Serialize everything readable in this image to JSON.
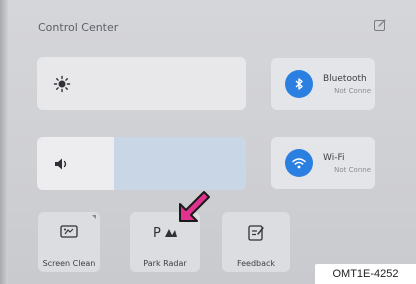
{
  "header": {
    "title": "Control Center",
    "edit_icon": "edit-square-icon"
  },
  "sliders": {
    "brightness": {
      "icon": "sun-icon",
      "level": 0.0
    },
    "volume": {
      "icon": "speaker-icon",
      "level": 0.37
    }
  },
  "toggles": {
    "bluetooth": {
      "label": "Bluetooth",
      "status": "Not Conne",
      "icon": "bluetooth-icon",
      "color": "#2a7fe0"
    },
    "wifi": {
      "label": "Wi-Fi",
      "status": "Not Conne",
      "icon": "wifi-icon",
      "color": "#2a7fe0"
    }
  },
  "tiles": {
    "screen_clean": {
      "label": "Screen Clean",
      "icon": "screen-clean-icon"
    },
    "park_radar": {
      "label": "Park Radar",
      "icon": "park-radar-icon"
    },
    "feedback": {
      "label": "Feedback",
      "icon": "feedback-icon"
    }
  },
  "annotation": {
    "code": "OMT1E-4252",
    "pointer_color": "#e0338f"
  }
}
